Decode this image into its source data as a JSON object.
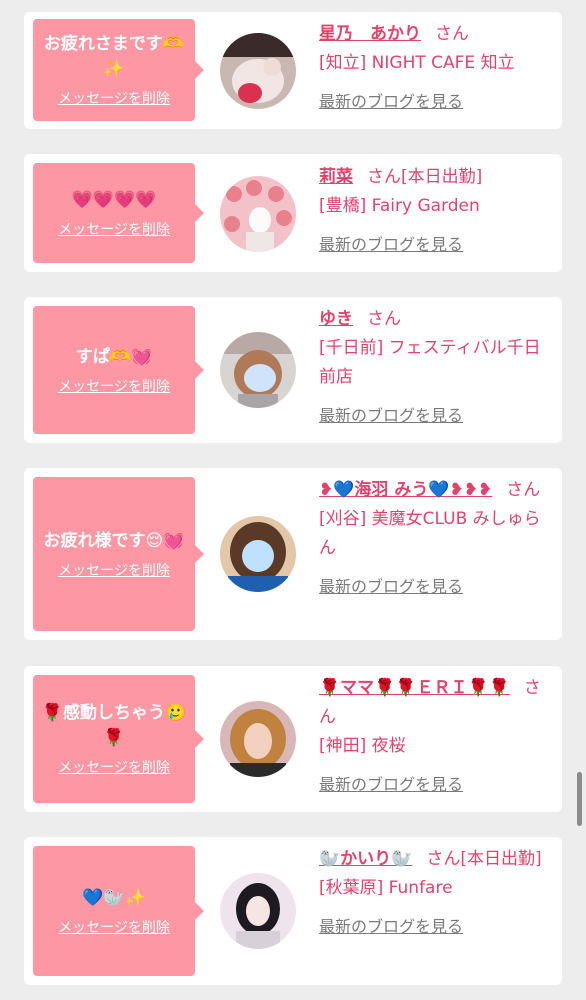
{
  "items": [
    {
      "message": "お疲れさまです🫶✨",
      "delete_label": "メッセージを削除",
      "name": "星乃　あかり",
      "san": "さん",
      "status": "",
      "shop": "[知立] NIGHT CAFE 知立",
      "blog_label": "最新のブログを見る"
    },
    {
      "message": "💗💗💗💗",
      "delete_label": "メッセージを削除",
      "name": "莉菜",
      "san": "さん",
      "status": "[本日出勤]",
      "shop": "[豊橋] Fairy Garden",
      "blog_label": "最新のブログを見る"
    },
    {
      "message": "すぱ🫶💓",
      "delete_label": "メッセージを削除",
      "name": "ゆき",
      "san": "さん",
      "status": "",
      "shop": "[千日前] フェスティバル千日前店",
      "blog_label": "最新のブログを見る"
    },
    {
      "message": "お疲れ様です😌💓",
      "delete_label": "メッセージを削除",
      "name": "❥💙海羽 みう💙❥❥❥",
      "san": "さん",
      "status": "",
      "shop": "[刈谷] 美魔女CLUB みしゅらん",
      "blog_label": "最新のブログを見る"
    },
    {
      "message": "🌹感動しちゃう🥲🌹",
      "delete_label": "メッセージを削除",
      "name": "🌹ママ🌹🌹ＥＲＩ🌹🌹",
      "san": "さん",
      "status": "",
      "shop": "[神田] 夜桜",
      "blog_label": "最新のブログを見る"
    },
    {
      "message": "💙🦭✨",
      "delete_label": "メッセージを削除",
      "name": "🦭かいり🦭",
      "san": "さん",
      "status": "[本日出勤]",
      "shop": "[秋葉原] Funfare",
      "blog_label": "最新のブログを見る"
    }
  ],
  "colors": {
    "accent": "#e2436d",
    "bubble": "#fd97a3",
    "background": "#ededee",
    "link_gray": "#7a7a7a"
  }
}
